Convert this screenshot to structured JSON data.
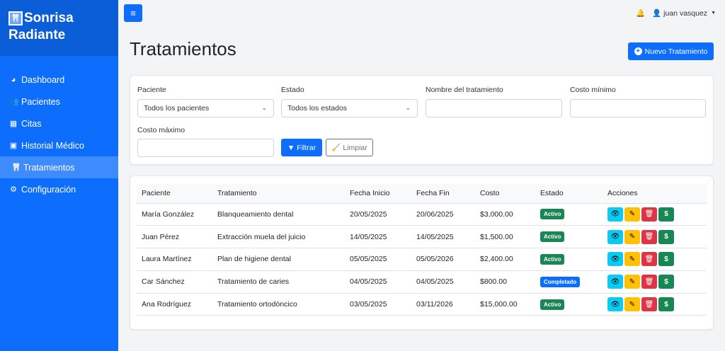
{
  "sidebar": {
    "brand_line1": "Sonrisa",
    "brand_line2": "Radiante",
    "items": [
      {
        "label": "Dashboard",
        "icon": "palette-icon"
      },
      {
        "label": "Pacientes",
        "icon": "users-icon"
      },
      {
        "label": "Citas",
        "icon": "calendar-icon"
      },
      {
        "label": "Historial Médico",
        "icon": "file-medical-icon"
      },
      {
        "label": "Tratamientos",
        "icon": "tooth-icon",
        "active": true
      },
      {
        "label": "Configuración",
        "icon": "gear-icon"
      }
    ]
  },
  "topbar": {
    "user_name": "juan vasquez"
  },
  "page": {
    "title": "Tratamientos",
    "new_button": "Nuevo Tratamiento"
  },
  "filters": {
    "patient_label": "Paciente",
    "patient_value": "Todos los pacientes",
    "status_label": "Estado",
    "status_value": "Todos los estados",
    "name_label": "Nombre del tratamiento",
    "name_value": "",
    "min_cost_label": "Costo mínimo",
    "min_cost_value": "",
    "max_cost_label": "Costo máximo",
    "max_cost_value": "",
    "filter_button": "Filtrar",
    "clear_button": "Limpiar"
  },
  "table": {
    "headers": [
      "Paciente",
      "Tratamiento",
      "Fecha Inicio",
      "Fecha Fin",
      "Costo",
      "Estado",
      "Acciones"
    ],
    "rows": [
      {
        "patient": "María González",
        "treatment": "Blanqueamiento dental",
        "start": "20/05/2025",
        "end": "20/06/2025",
        "cost": "$3,000.00",
        "status": "Activo"
      },
      {
        "patient": "Juan Pérez",
        "treatment": "Extracción muela del juicio",
        "start": "14/05/2025",
        "end": "14/05/2025",
        "cost": "$1,500.00",
        "status": "Activo"
      },
      {
        "patient": "Laura Martínez",
        "treatment": "Plan de higiene dental",
        "start": "05/05/2025",
        "end": "05/05/2026",
        "cost": "$2,400.00",
        "status": "Activo"
      },
      {
        "patient": "Car Sánchez",
        "treatment": "Tratamiento de caries",
        "start": "04/05/2025",
        "end": "04/05/2025",
        "cost": "$800.00",
        "status": "Completado"
      },
      {
        "patient": "Ana Rodríguez",
        "treatment": "Tratamiento ortodóncico",
        "start": "03/05/2025",
        "end": "03/11/2026",
        "cost": "$15,000.00",
        "status": "Activo"
      }
    ]
  },
  "colors": {
    "primary": "#0d6efd",
    "active_badge": "#198754",
    "completed_badge": "#0d6efd"
  }
}
